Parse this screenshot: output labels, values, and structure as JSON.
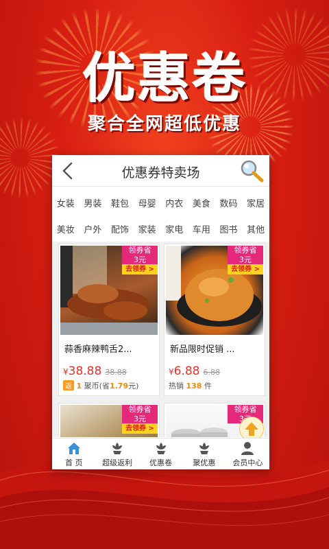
{
  "hero": {
    "title": "优惠卷",
    "subtitle": "聚合全网超低优惠"
  },
  "header": {
    "title": "优惠券特卖场",
    "back_icon": "chevron-left-icon",
    "search_icon": "magnifier-icon"
  },
  "categories_row1": [
    "女装",
    "男装",
    "鞋包",
    "母婴",
    "内衣",
    "美食",
    "数码",
    "家居"
  ],
  "categories_row2": [
    "美妆",
    "户外",
    "配饰",
    "家装",
    "家电",
    "车用",
    "图书",
    "其他"
  ],
  "products": [
    {
      "coupon_label": "领券省",
      "coupon_value": "3元",
      "coupon_action": "去领券 >",
      "name": "蒜香麻辣鸭舌2...",
      "price_symbol": "¥",
      "price": "38.88",
      "old_price": "38.88",
      "tag": "返",
      "tag_count": "1",
      "tag_text": "聚币(省",
      "tag_save": "1.79",
      "tag_end": "元)"
    },
    {
      "coupon_label": "领券省",
      "coupon_value": "3元",
      "coupon_action": "去领券 >",
      "name": "新品限时促销 ...",
      "price_symbol": "¥",
      "price": "6.88",
      "old_price": "6.88",
      "sales_label": "热销",
      "sales_count": "138",
      "sales_unit": "件"
    },
    {
      "coupon_label": "领券省",
      "coupon_value": "3元",
      "coupon_action": "去领券 >"
    },
    {
      "coupon_label": "领券省",
      "coupon_value": "3元"
    }
  ],
  "tabs": [
    {
      "label": "首 页",
      "icon": "home-icon"
    },
    {
      "label": "超级返利",
      "icon": "flower-icon"
    },
    {
      "label": "优惠卷",
      "icon": "flower-icon"
    },
    {
      "label": "聚优惠",
      "icon": "flower-icon"
    },
    {
      "label": "会员中心",
      "icon": "user-icon"
    }
  ],
  "colors": {
    "accent": "#e6287a",
    "price": "#e8312a",
    "background": "#d81e12",
    "coupon_action_bg": "#ffd21e"
  }
}
